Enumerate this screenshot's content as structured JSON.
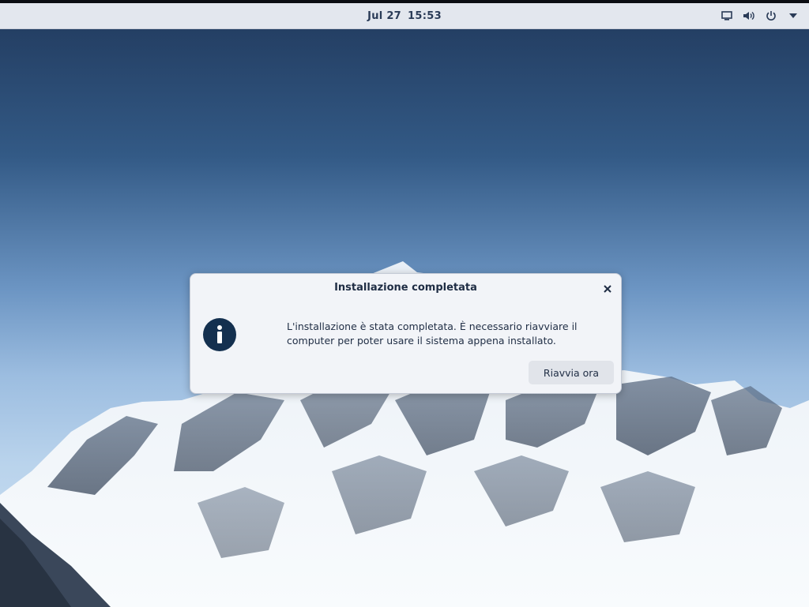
{
  "topbar": {
    "date": "Jul 27",
    "time": "15:53",
    "icons": [
      "screen-icon",
      "volume-icon",
      "power-icon",
      "menu-arrow-icon"
    ]
  },
  "dialog": {
    "title": "Installazione completata",
    "message": "L'installazione è stata completata. È necessario riavviare il computer per poter usare il sistema appena installato.",
    "restart_label": "Riavvia ora",
    "close_icon": "close-icon",
    "info_icon": "info-icon"
  },
  "colors": {
    "topbar_bg": "#e3e7ee",
    "dialog_bg": "#f2f4f8",
    "info_icon_bg": "#14304f",
    "text": "#1f2d44"
  }
}
